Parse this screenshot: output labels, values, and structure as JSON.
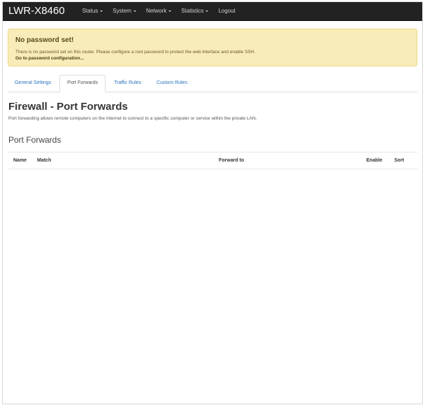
{
  "navbar": {
    "brand": "LWR-X8460",
    "items": [
      {
        "label": "Status",
        "has_menu": true
      },
      {
        "label": "System",
        "has_menu": true
      },
      {
        "label": "Network",
        "has_menu": true
      },
      {
        "label": "Statistics",
        "has_menu": true
      },
      {
        "label": "Logout",
        "has_menu": false
      }
    ]
  },
  "alert": {
    "title": "No password set!",
    "text": "There is no password set on this router. Please configure a root password to protect the web interface and enable SSH.",
    "link": "Go to password configuration..."
  },
  "tabs": [
    {
      "label": "General Settings",
      "active": false
    },
    {
      "label": "Port Forwards",
      "active": true
    },
    {
      "label": "Traffic Rules",
      "active": false
    },
    {
      "label": "Custom Rules",
      "active": false
    }
  ],
  "page": {
    "title": "Firewall - Port Forwards",
    "description": "Port forwarding allows remote computers on the Internet to connect to a specific computer or service within the private LAN.",
    "section_title": "Port Forwards"
  },
  "table": {
    "columns": [
      "Name",
      "Match",
      "Forward to",
      "Enable",
      "Sort"
    ],
    "rows": []
  },
  "colors": {
    "navbar_bg": "#222222",
    "alert_bg": "#f8ecb8",
    "link": "#2a73c0"
  }
}
